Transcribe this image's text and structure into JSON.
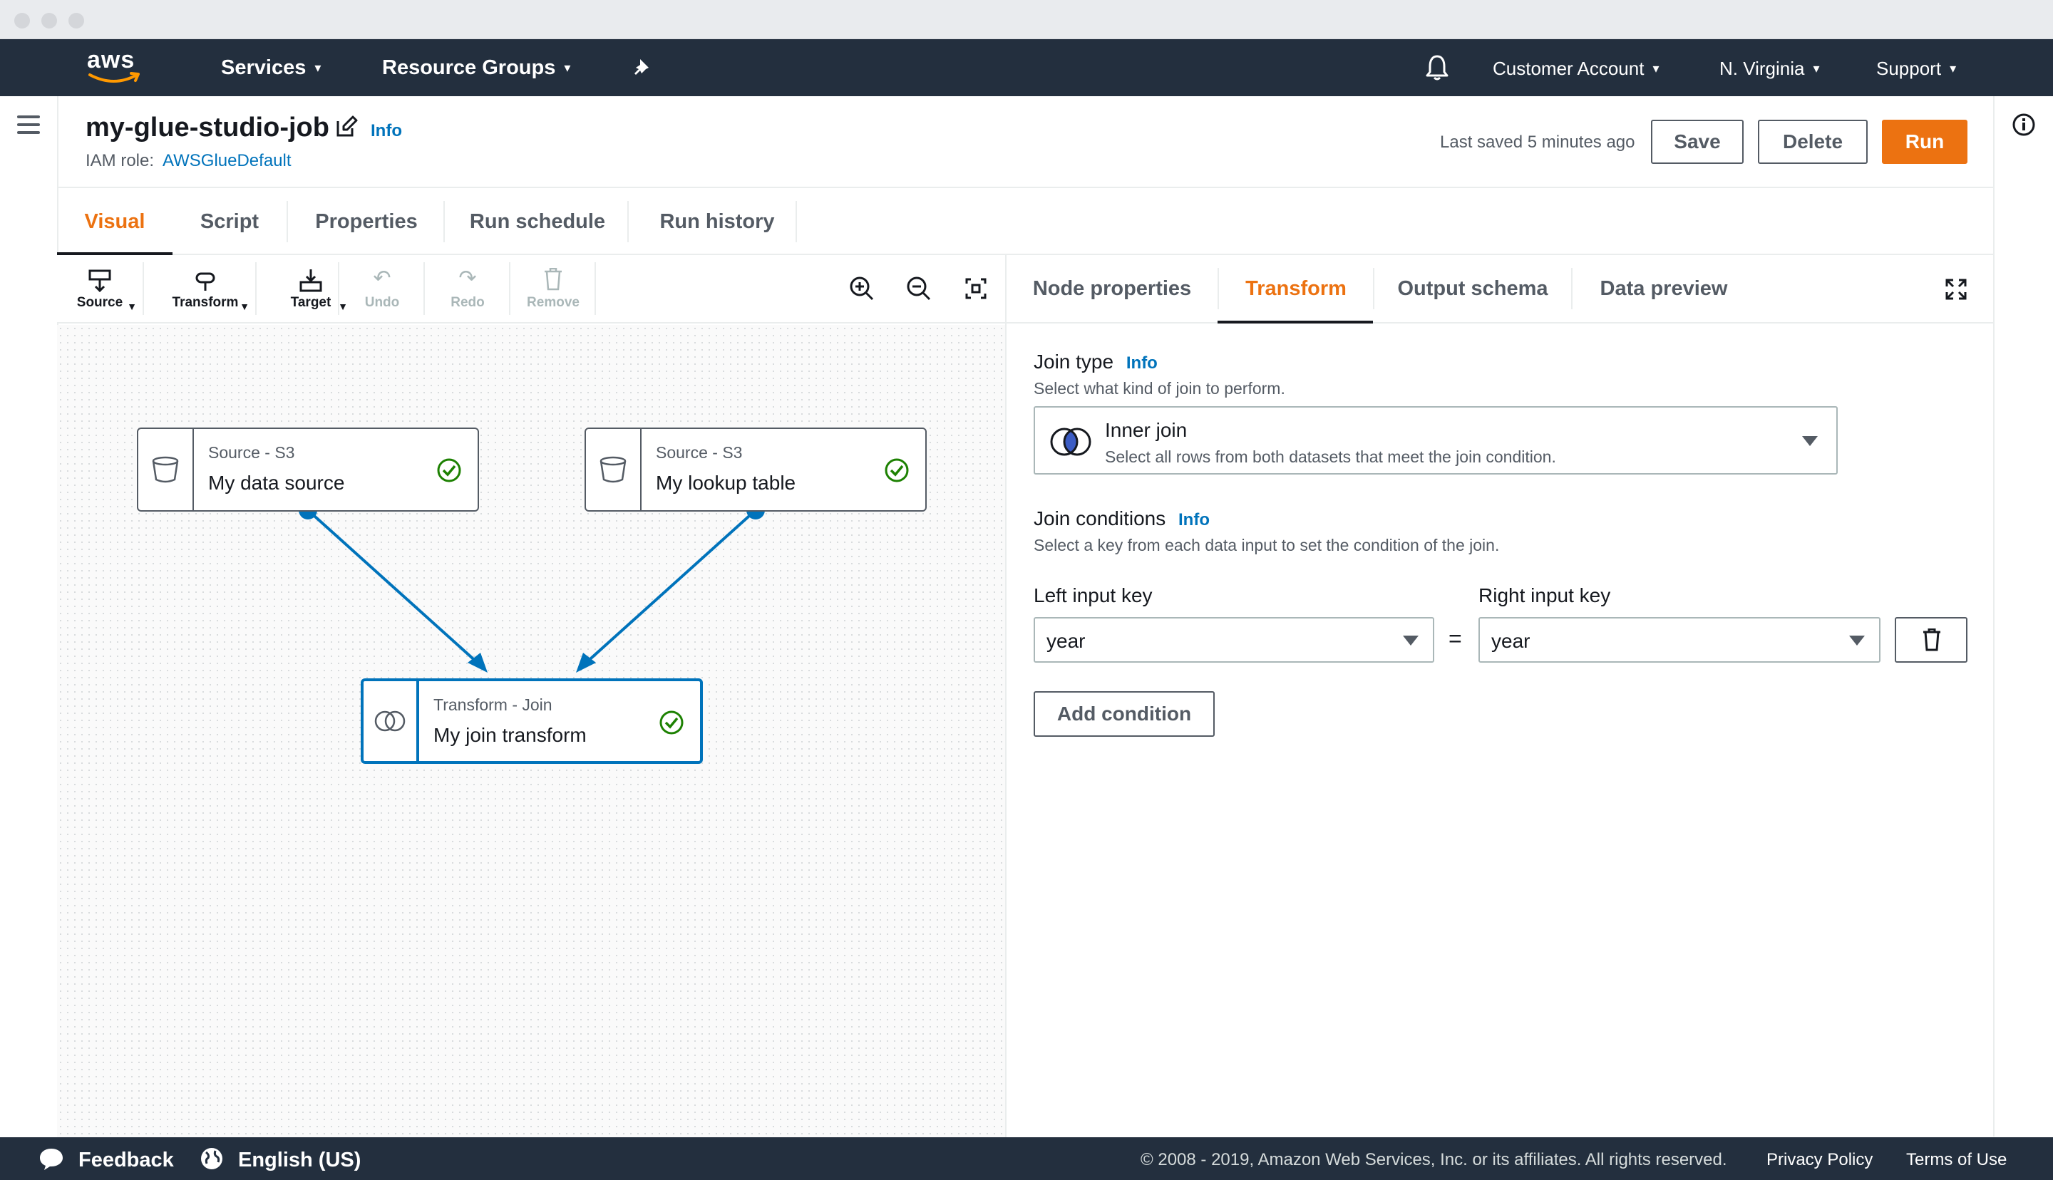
{
  "topnav": {
    "logo": "aws",
    "services": "Services",
    "resource_groups": "Resource Groups",
    "account": "Customer Account",
    "region": "N. Virginia",
    "support": "Support"
  },
  "header": {
    "job_title": "my-glue-studio-job",
    "info": "Info",
    "iam_label": "IAM role:",
    "iam_role": "AWSGlueDefault",
    "last_saved": "Last saved 5 minutes ago",
    "save": "Save",
    "delete": "Delete",
    "run": "Run"
  },
  "main_tabs": [
    "Visual",
    "Script",
    "Properties",
    "Run schedule",
    "Run history"
  ],
  "toolbar": {
    "source": "Source",
    "transform": "Transform",
    "target": "Target",
    "undo": "Undo",
    "redo": "Redo",
    "remove": "Remove"
  },
  "nodes": {
    "source1": {
      "type": "Source - S3",
      "name": "My data source"
    },
    "source2": {
      "type": "Source - S3",
      "name": "My lookup table"
    },
    "join": {
      "type": "Transform - Join",
      "name": "My join transform"
    }
  },
  "panel_tabs": [
    "Node properties",
    "Transform",
    "Output schema",
    "Data preview"
  ],
  "transform": {
    "join_type_label": "Join type",
    "join_type_info": "Info",
    "join_type_desc": "Select what kind of join to perform.",
    "join_type_value": "Inner join",
    "join_type_value_desc": "Select all rows from both datasets that meet the join condition.",
    "conditions_label": "Join conditions",
    "conditions_info": "Info",
    "conditions_desc": "Select a key from each data input to set the condition of the join.",
    "left_key_label": "Left input key",
    "right_key_label": "Right input key",
    "left_key_value": "year",
    "right_key_value": "year",
    "equals": "=",
    "add_condition": "Add condition"
  },
  "footer": {
    "feedback": "Feedback",
    "language": "English (US)",
    "copyright": "© 2008 - 2019, Amazon Web Services, Inc. or its affiliates. All rights reserved.",
    "privacy": "Privacy Policy",
    "terms": "Terms of Use"
  },
  "colors": {
    "nav_bg": "#232f3e",
    "accent_orange": "#ec7211",
    "link_blue": "#0073bb",
    "success_green": "#1d8102"
  }
}
